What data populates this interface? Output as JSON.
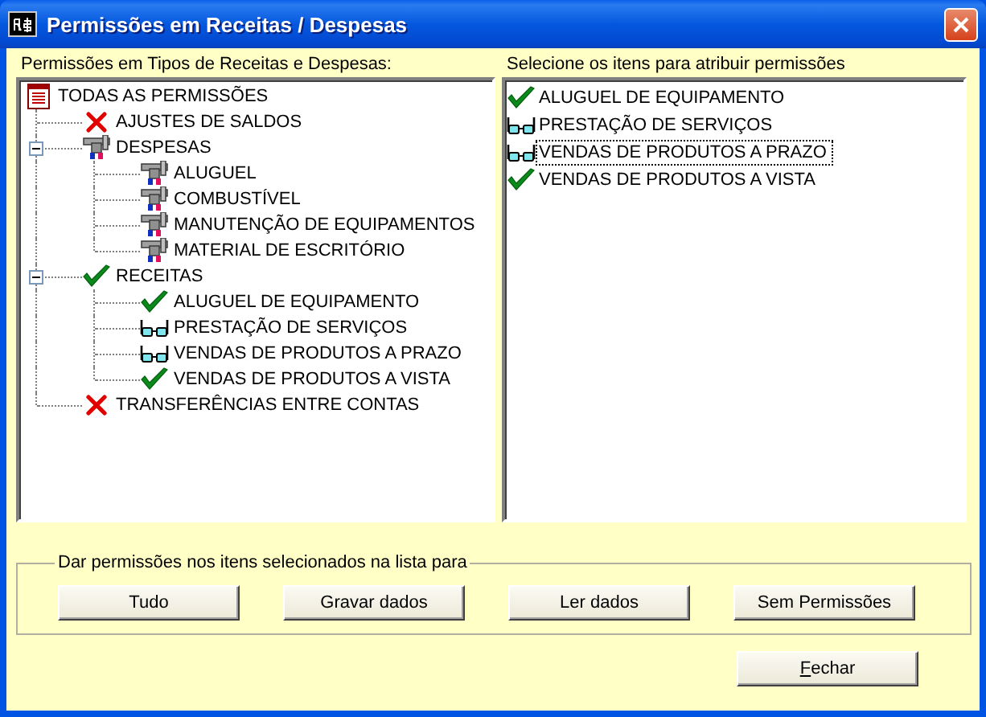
{
  "window": {
    "title": "Permissões em Receitas / Despesas"
  },
  "tree": {
    "label": "Permissões em Tipos de Receitas e Despesas:",
    "root": {
      "kind": "all",
      "label": "TODAS AS PERMISSÕES",
      "children": [
        {
          "kind": "denied",
          "label": "AJUSTES DE SALDOS"
        },
        {
          "kind": "expense",
          "label": "DESPESAS",
          "expanded": true,
          "children": [
            {
              "kind": "expense",
              "label": "ALUGUEL"
            },
            {
              "kind": "expense",
              "label": "COMBUSTÍVEL"
            },
            {
              "kind": "expense",
              "label": "MANUTENÇÃO DE EQUIPAMENTOS"
            },
            {
              "kind": "expense",
              "label": "MATERIAL DE ESCRITÓRIO"
            }
          ]
        },
        {
          "kind": "granted",
          "label": "RECEITAS",
          "expanded": true,
          "children": [
            {
              "kind": "granted",
              "label": "ALUGUEL DE EQUIPAMENTO"
            },
            {
              "kind": "read",
              "label": "PRESTAÇÃO DE SERVIÇOS"
            },
            {
              "kind": "read",
              "label": "VENDAS DE PRODUTOS A PRAZO"
            },
            {
              "kind": "granted",
              "label": "VENDAS DE PRODUTOS A VISTA"
            }
          ]
        },
        {
          "kind": "denied",
          "label": "TRANSFERÊNCIAS ENTRE CONTAS"
        }
      ]
    }
  },
  "list": {
    "label": "Selecione os itens para atribuir permissões",
    "items": [
      {
        "kind": "granted",
        "label": "ALUGUEL DE EQUIPAMENTO",
        "focused": false
      },
      {
        "kind": "read",
        "label": "PRESTAÇÃO DE SERVIÇOS",
        "focused": false
      },
      {
        "kind": "read",
        "label": "VENDAS DE PRODUTOS A PRAZO",
        "focused": true
      },
      {
        "kind": "granted",
        "label": "VENDAS DE PRODUTOS A VISTA",
        "focused": false
      }
    ]
  },
  "group": {
    "label": "Dar permissões nos itens selecionados na lista para",
    "buttons": [
      "Tudo",
      "Gravar dados",
      "Ler dados",
      "Sem Permissões"
    ]
  },
  "close_button": {
    "label": "Fechar",
    "mnemonic_underlined": true
  }
}
